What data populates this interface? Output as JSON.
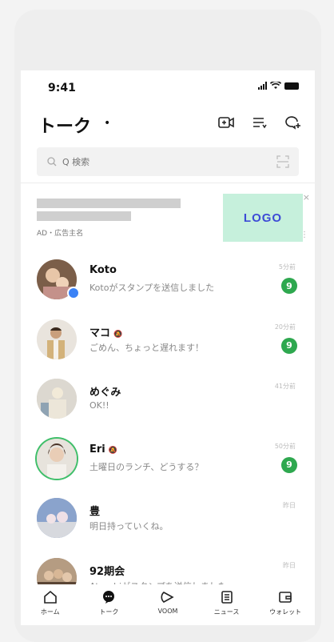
{
  "status_bar": {
    "time": "9:41"
  },
  "header": {
    "title": "トーク",
    "dropdown_caret": "•"
  },
  "search": {
    "placeholder": "Q 検索"
  },
  "ad": {
    "label": "AD・広告主名",
    "logo_text": "LOGO",
    "close_glyph": "×",
    "more_glyph": "⋮"
  },
  "chats": [
    {
      "name": "Koto",
      "muted": false,
      "message": "Kotoがスタンプを送信しました",
      "time": "5分前",
      "unread": "9",
      "avatar_color": "#c9a98f",
      "verified": true
    },
    {
      "name": "マコ",
      "muted": true,
      "message": "ごめん、ちょっと遅れます！",
      "time": "20分前",
      "unread": "9",
      "avatar_color": "#a88f76",
      "verified": false
    },
    {
      "name": "めぐみ",
      "muted": false,
      "message": "OK!!",
      "time": "41分前",
      "unread": "",
      "avatar_color": "#c8c4bc",
      "verified": false
    },
    {
      "name": "Eri",
      "muted": true,
      "message": "土曜日のランチ、どうする？",
      "time": "50分前",
      "unread": "9",
      "avatar_color": "#d8cfc2",
      "verified": false
    },
    {
      "name": "豊",
      "muted": false,
      "message": "明日持っていくね。",
      "time": "昨日",
      "unread": "",
      "avatar_color": "#7f95bb",
      "verified": false
    },
    {
      "name": "92期会",
      "muted": false,
      "message": "Atsushiがスタンプを送信しました",
      "time": "昨日",
      "unread": "",
      "avatar_color": "#9a7d62",
      "verified": false
    }
  ],
  "tabs": [
    {
      "label": "ホーム",
      "icon": "home-icon"
    },
    {
      "label": "トーク",
      "icon": "talk-icon"
    },
    {
      "label": "VOOM",
      "icon": "voom-icon"
    },
    {
      "label": "ニュース",
      "icon": "news-icon"
    },
    {
      "label": "ウォレット",
      "icon": "wallet-icon"
    }
  ],
  "colors": {
    "accent": "#2ea84f",
    "logo_bg": "#c6f0dc",
    "logo_text": "#3d4bd6"
  }
}
